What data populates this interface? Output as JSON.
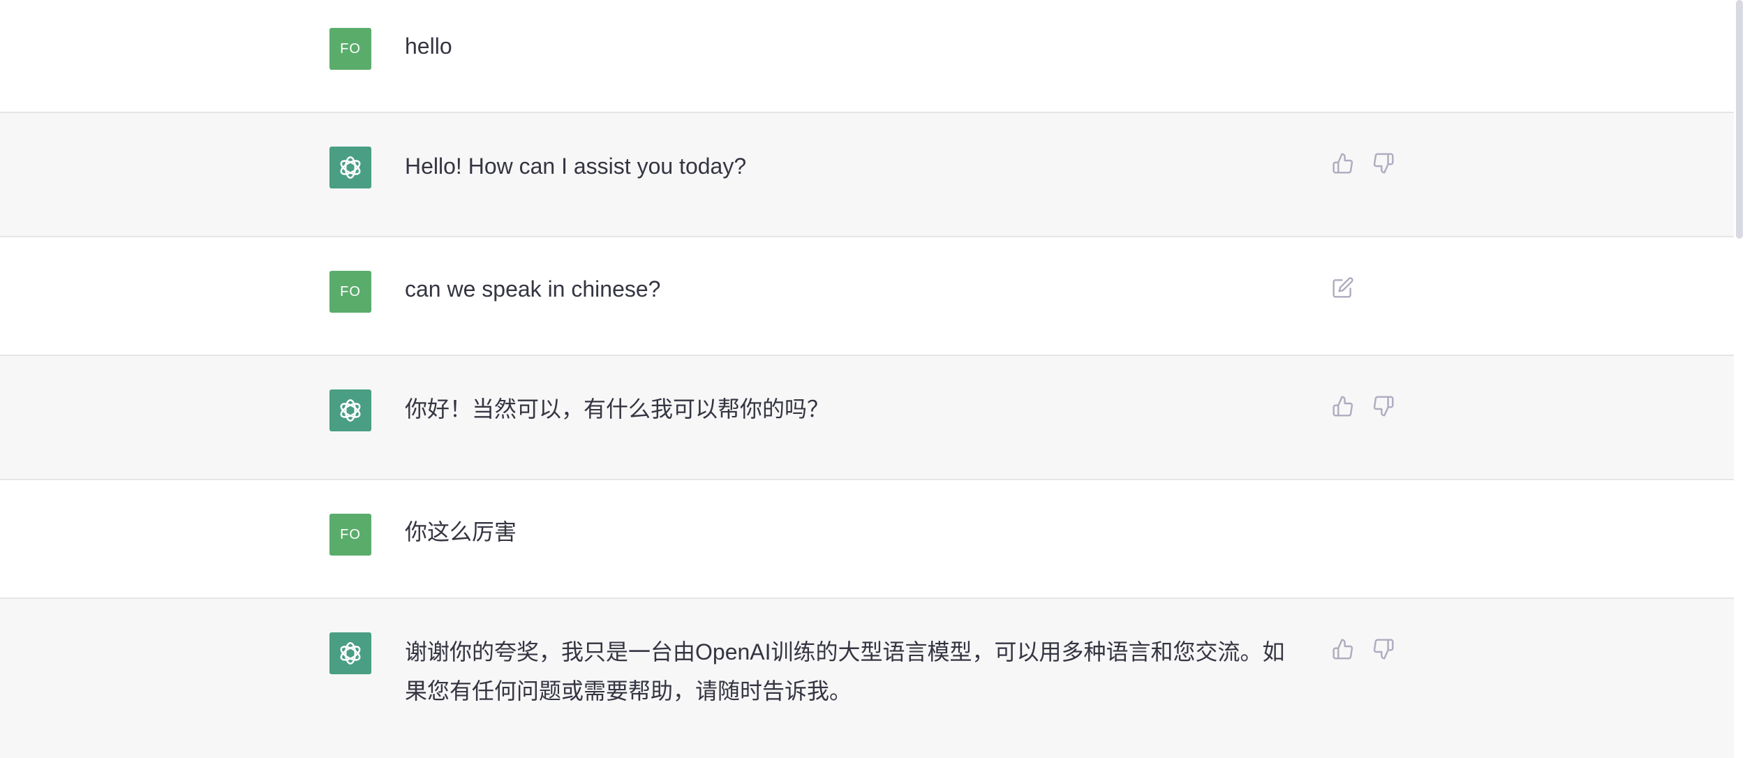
{
  "messages": [
    {
      "role": "user",
      "avatar_text": "FO",
      "text": "hello"
    },
    {
      "role": "assistant",
      "text": "Hello! How can I assist you today?",
      "actions": [
        "thumbs-up-icon",
        "thumbs-down-icon"
      ]
    },
    {
      "role": "user",
      "avatar_text": "FO",
      "text": "can we speak in chinese?",
      "actions": [
        "edit-icon"
      ]
    },
    {
      "role": "assistant",
      "text": "你好！当然可以，有什么我可以帮你的吗？",
      "actions": [
        "thumbs-up-icon",
        "thumbs-down-icon"
      ]
    },
    {
      "role": "user",
      "avatar_text": "FO",
      "text": "你这么厉害"
    },
    {
      "role": "assistant",
      "text": "谢谢你的夸奖，我只是一台由OpenAI训练的大型语言模型，可以用多种语言和您交流。如果您有任何问题或需要帮助，请随时告诉我。",
      "actions": [
        "thumbs-up-icon",
        "thumbs-down-icon"
      ]
    }
  ],
  "colors": {
    "user_avatar": "#5aac6b",
    "assistant_avatar": "#4a9e84",
    "assistant_bg": "#f7f7f8",
    "text": "#343541",
    "icon": "#acacbe"
  }
}
